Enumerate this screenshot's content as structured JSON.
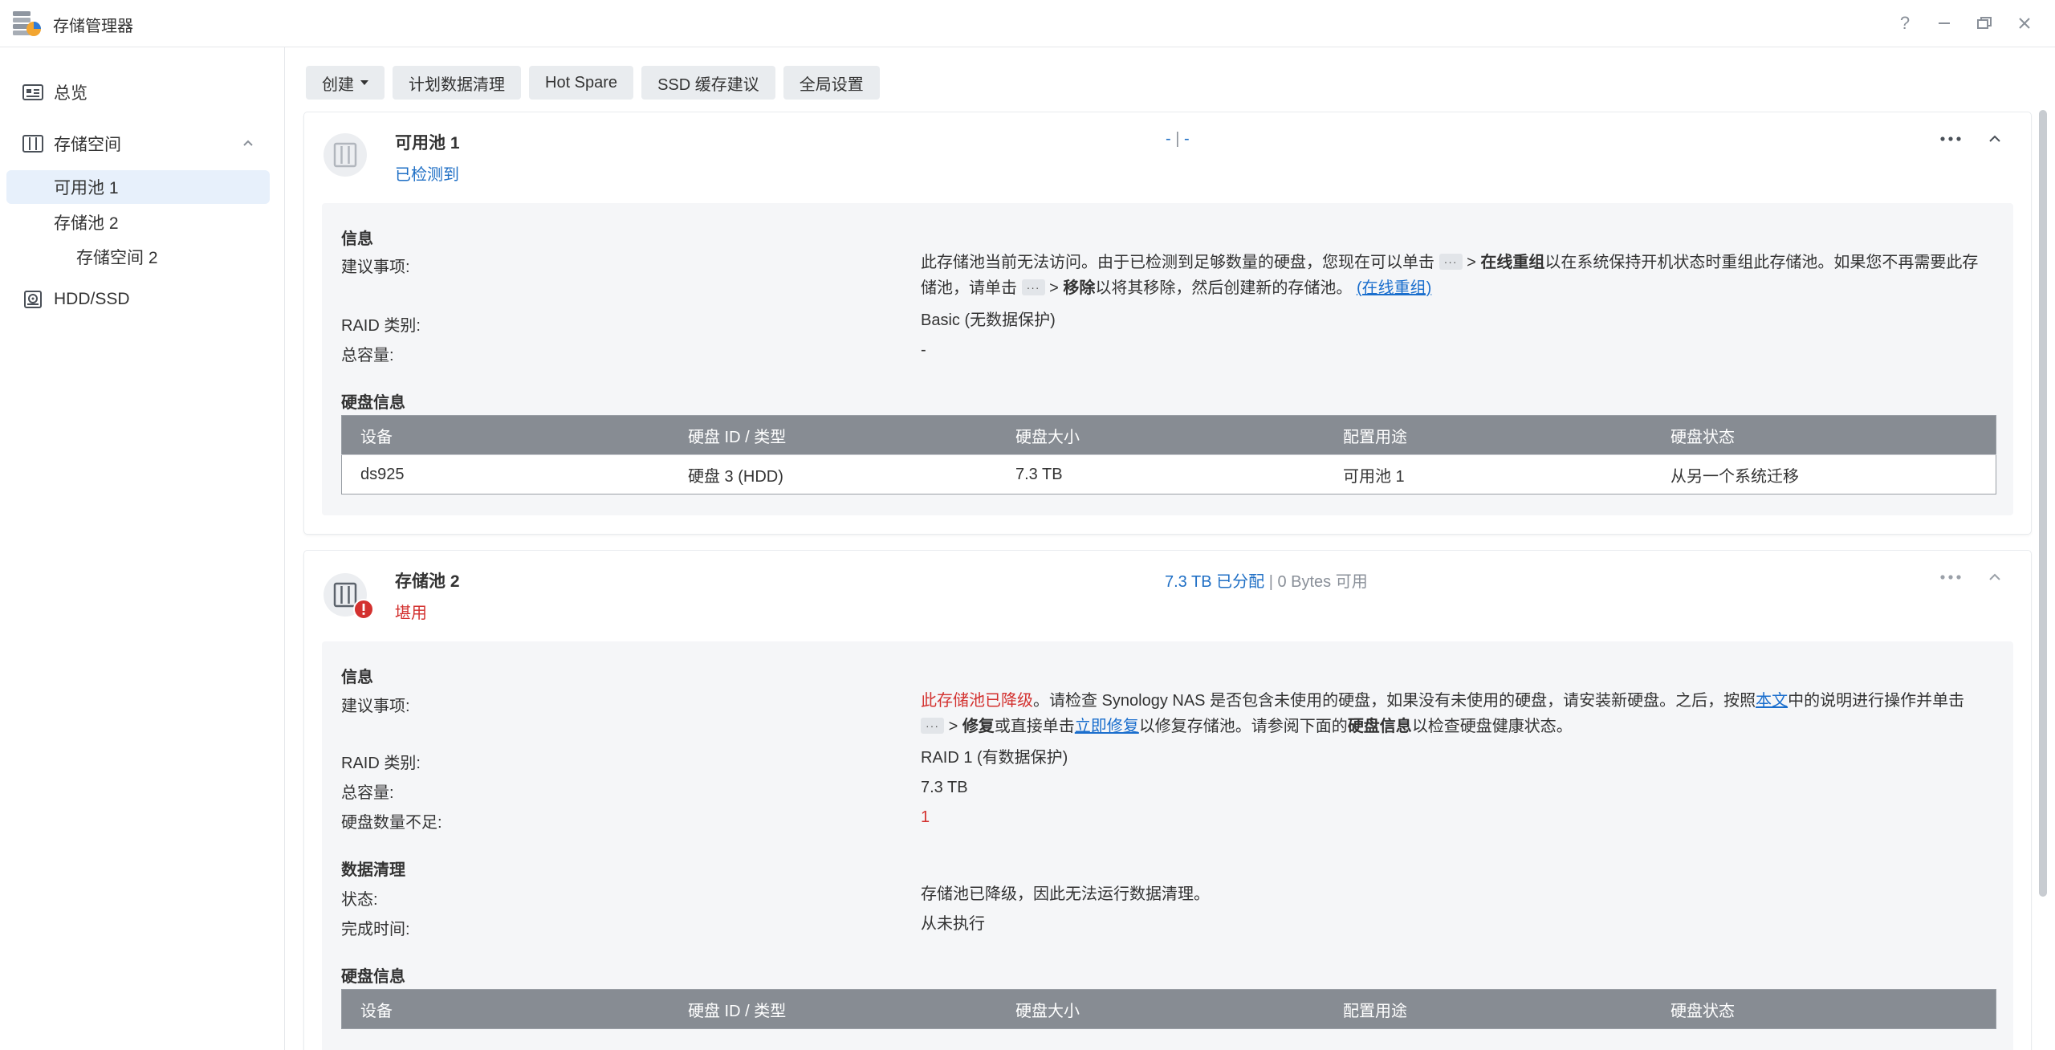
{
  "window": {
    "title": "存储管理器",
    "buttons": [
      "help-icon",
      "minimize-icon",
      "restore-icon",
      "close-icon"
    ]
  },
  "sidebar": {
    "overview": {
      "label": "总览",
      "icon": "overview-icon"
    },
    "storage": {
      "label": "存储空间",
      "icon": "storage-icon",
      "expanded": true
    },
    "pool1": {
      "label": "可用池 1"
    },
    "pool2": {
      "label": "存储池 2"
    },
    "volume2": {
      "label": "存储空间 2"
    },
    "hdd": {
      "label": "HDD/SSD",
      "icon": "disk-icon"
    }
  },
  "toolbar": {
    "create": "创建",
    "scrub": "计划数据清理",
    "hotspare": "Hot Spare",
    "ssd": "SSD 缓存建议",
    "global": "全局设置"
  },
  "pool1": {
    "name": "可用池 1",
    "status": "已检测到",
    "cap_used": "-",
    "cap_sep": "|",
    "cap_free": "-",
    "info_title": "信息",
    "advice_label": "建议事项:",
    "advice_part1": "此存储池当前无法访问。由于已检测到足够数量的硬盘，您现在可以单击",
    "advice_gt1": ">",
    "advice_bold1": "在线重组",
    "advice_part2": "以在系统保持开机状态时重组此存储池。如果您不再需要此存储池，请单击",
    "advice_gt2": ">",
    "advice_bold2": "移除",
    "advice_part3": "以将其移除，然后创建新的存储池。",
    "advice_link": "(在线重组)",
    "raid_label": "RAID 类别:",
    "raid_value": "Basic (无数据保护)",
    "total_label": "总容量:",
    "total_value": "-",
    "disk_title": "硬盘信息",
    "table_headers": [
      "设备",
      "硬盘 ID / 类型",
      "硬盘大小",
      "配置用途",
      "硬盘状态"
    ],
    "disks": [
      {
        "device": "ds925",
        "id": "硬盘 3 (HDD)",
        "size": "7.3 TB",
        "usage": "可用池 1",
        "state": "从另一个系统迁移"
      }
    ]
  },
  "pool2": {
    "name": "存储池 2",
    "status": "堪用",
    "cap_used": "7.3 TB 已分配",
    "cap_sep": "|",
    "cap_free": "0 Bytes 可用",
    "info_title": "信息",
    "advice_label": "建议事项:",
    "advice_red": "此存储池已降级",
    "advice_part1": "。请检查 Synology NAS 是否包含未使用的硬盘，如果没有未使用的硬盘，请安装新硬盘。之后，按照",
    "advice_link1": "本文",
    "advice_part2": "中的说明进行操作并单击",
    "advice_gt": ">",
    "advice_bold1": "修复",
    "advice_part3": "或直接单击",
    "advice_link2": "立即修复",
    "advice_part4": "以修复存储池。请参阅下面的",
    "advice_bold2": "硬盘信息",
    "advice_part5": "以检查硬盘健康状态。",
    "raid_label": "RAID 类别:",
    "raid_value": "RAID 1 (有数据保护)",
    "total_label": "总容量:",
    "total_value": "7.3 TB",
    "insufficient_label": "硬盘数量不足:",
    "insufficient_value": "1",
    "scrub_title": "数据清理",
    "scrub_status_label": "状态:",
    "scrub_status_value": "存储池已降级，因此无法运行数据清理。",
    "scrub_time_label": "完成时间:",
    "scrub_time_value": "从未执行",
    "disk_title": "硬盘信息",
    "table_headers": [
      "设备",
      "硬盘 ID / 类型",
      "硬盘大小",
      "配置用途",
      "硬盘状态"
    ]
  },
  "ellipsis": "···",
  "colors": {
    "accent": "#1f6fc5",
    "danger": "#d3312f",
    "active_bg": "#e7f0fb",
    "table_header": "#878c93"
  }
}
